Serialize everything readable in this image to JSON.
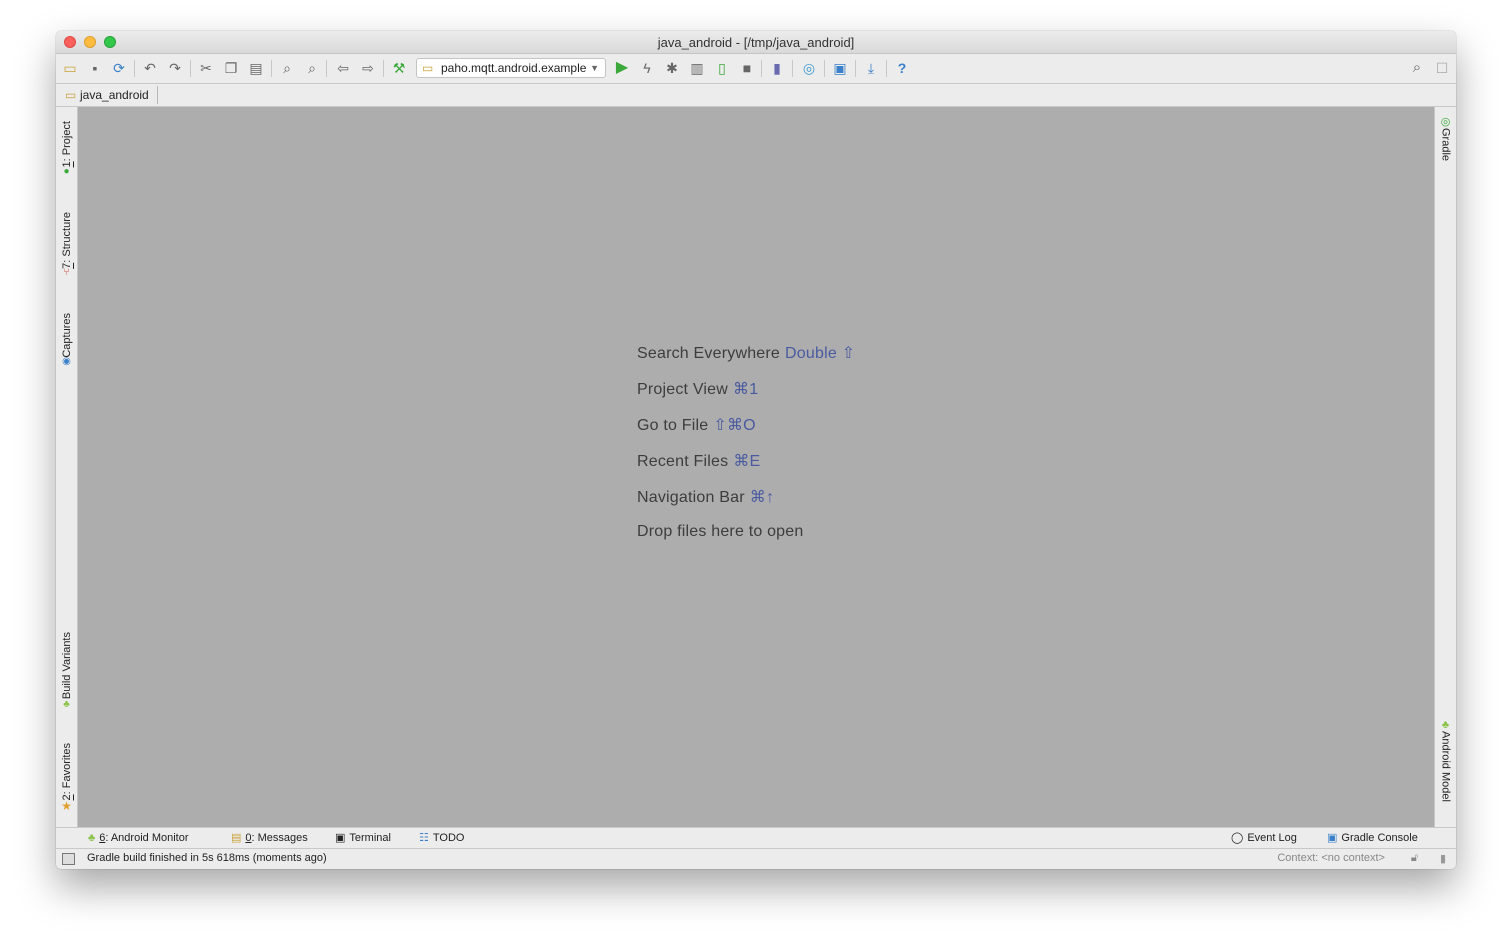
{
  "window": {
    "title": "java_android - [/tmp/java_android]"
  },
  "toolbar": {
    "run_config": "paho.mqtt.android.example",
    "icons": [
      "open-folder-icon",
      "save-icon",
      "sync-icon",
      "undo-icon",
      "redo-icon",
      "cut-icon",
      "copy-icon",
      "paste-icon",
      "find-icon",
      "replace-icon",
      "back-icon",
      "forward-icon",
      "make-project-icon",
      "run-icon",
      "apply-changes-icon",
      "debug-icon",
      "profile-icon",
      "attach-debugger-icon",
      "stop-icon",
      "avd-manager-icon",
      "sync-gradle-icon",
      "project-structure-icon",
      "sdk-manager-icon",
      "help-icon",
      "search-everywhere-icon",
      "user-icon"
    ]
  },
  "navbar": {
    "crumb": "java_android"
  },
  "left_tabs": {
    "project": {
      "num": "1",
      "label": ": Project"
    },
    "structure": {
      "num": "7",
      "label": ": Structure"
    },
    "captures": {
      "label": "Captures"
    },
    "build_variants": {
      "label": "Build Variants"
    },
    "favorites": {
      "num": "2",
      "label": ": Favorites"
    }
  },
  "right_tabs": {
    "gradle": "Gradle",
    "android_model": "Android Model"
  },
  "editor": {
    "hints": [
      {
        "text": "Search Everywhere",
        "key": "Double ⇧"
      },
      {
        "text": "Project View",
        "key": "⌘1"
      },
      {
        "text": "Go to File",
        "key": "⇧⌘O"
      },
      {
        "text": "Recent Files",
        "key": "⌘E"
      },
      {
        "text": "Navigation Bar",
        "key": "⌘↑"
      },
      {
        "text": "Drop files here to open",
        "key": ""
      }
    ]
  },
  "bottom_tabs": {
    "android_monitor": {
      "num": "6",
      "label": ": Android Monitor"
    },
    "messages": {
      "num": "0",
      "label": ": Messages"
    },
    "terminal": {
      "label": "Terminal"
    },
    "todo": {
      "label": "TODO"
    },
    "event_log": {
      "label": "Event Log"
    },
    "gradle_console": {
      "label": "Gradle Console"
    }
  },
  "status": {
    "message": "Gradle build finished in 5s 618ms (moments ago)",
    "context": "Context: <no context>"
  },
  "colors": {
    "editor_bg": "#adadad",
    "hint_text": "#3d3d3d",
    "shortcut_text": "#4a5aa0",
    "run_green": "#3aa83a",
    "android_green": "#8bc34a"
  }
}
